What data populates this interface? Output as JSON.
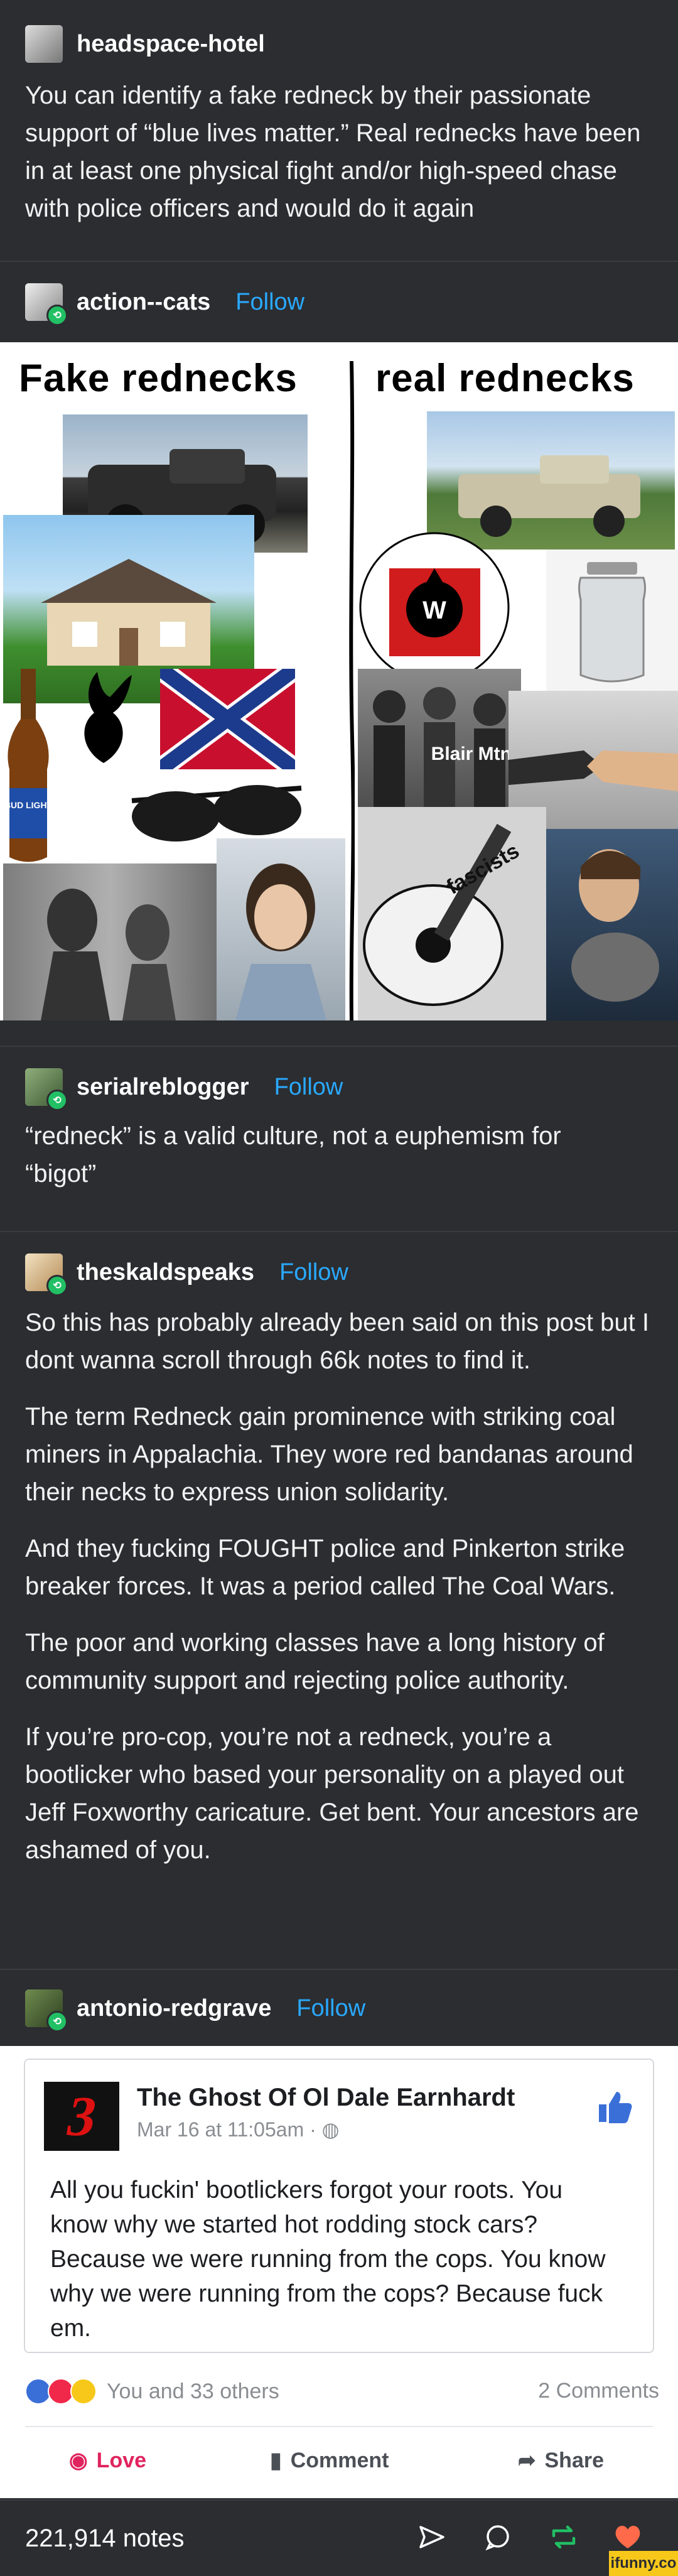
{
  "posts": [
    {
      "username": "headspace-hotel",
      "follow_label": "",
      "paragraphs": [
        "You can identify a fake redneck by their passionate support of “blue lives matter.” Real rednecks have been in at least one physical fight and/or high-speed chase with police officers and would do it again"
      ]
    },
    {
      "username": "action--cats",
      "follow_label": "Follow",
      "image": {
        "left_heading": "Fake rednecks",
        "right_heading": "real rednecks",
        "beer_label": "BUD LIGHT",
        "blair_label": "Blair Mtn.",
        "guitar_label": "fascists"
      }
    },
    {
      "username": "serialreblogger",
      "follow_label": "Follow",
      "paragraphs": [
        "“redneck” is a valid culture, not a euphemism for “bigot”"
      ]
    },
    {
      "username": "theskaldspeaks",
      "follow_label": "Follow",
      "paragraphs": [
        "So this has probably already been said on this post but I dont wanna scroll through 66k notes to find it.",
        "The term Redneck gain prominence with striking coal miners in Appalachia. They wore red bandanas around their necks to express union solidarity.",
        "And they fucking FOUGHT police and Pinkerton strike breaker forces. It was a period called The Coal Wars.",
        "The poor and working classes have a long history of community support and rejecting police authority.",
        "If you’re pro-cop, you’re not a redneck, you’re a bootlicker who based your personality on a played out Jeff Foxworthy caricature. Get bent. Your ancestors are ashamed of you."
      ]
    },
    {
      "username": "antonio-redgrave",
      "follow_label": "Follow"
    }
  ],
  "facebook": {
    "page_name": "The Ghost Of Ol Dale Earnhardt",
    "date": "Mar 16 at 11:05am · ",
    "logo_text": "3",
    "text": "All you fuckin' bootlickers forgot your roots. You know why we started hot rodding stock cars? Because we were running from the cops. You know why we were running from the cops? Because fuck em.",
    "reactions_text": "You and 33 others",
    "comments": "2 Comments",
    "love_label": "Love",
    "comment_label": "Comment",
    "share_label": "Share"
  },
  "footer": {
    "notes": "221,914 notes",
    "watermark": "ifunny.co"
  },
  "colors": {
    "background": "#2b2d31",
    "follow": "#2aa9ff",
    "reblog_badge": "#21c064",
    "heart": "#ff6b4a"
  }
}
